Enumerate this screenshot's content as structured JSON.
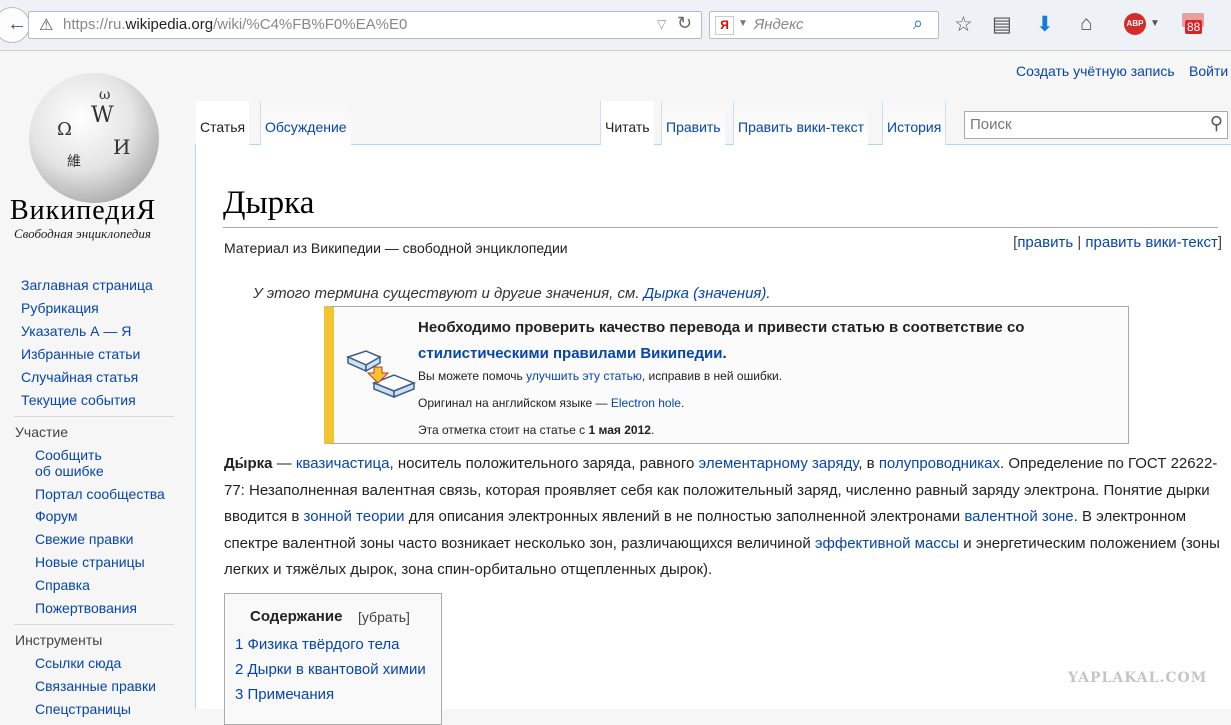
{
  "browser": {
    "back_glyph": "←",
    "warn_glyph": "⚠",
    "url_prefix": "https://ru.",
    "url_domain": "wikipedia.org",
    "url_path": "/wiki/%C4%FB%F0%EA%E0",
    "dropdown_glyph": "▽",
    "reload_glyph": "↻",
    "search_engine_logo": "Я",
    "search_placeholder": "Яндекс",
    "search_glyph": "⌕",
    "icons": [
      "star-icon",
      "reading-list-icon",
      "download-icon",
      "home-icon",
      "adblock-plus-icon",
      "mail-icon"
    ],
    "icon_glyphs": [
      "☆",
      "▤",
      "⬇",
      "⌂"
    ],
    "abp_label": "ABP",
    "mail_badge": "88"
  },
  "logo": {
    "globe_glyphs": [
      "Ω",
      "W",
      "И",
      "維",
      "ω"
    ],
    "wordmark": "ВикипедиЯ",
    "tagline": "Свободная энциклопедия"
  },
  "sidebar": {
    "main_links": [
      "Заглавная страница",
      "Рубрикация",
      "Указатель А — Я",
      "Избранные статьи",
      "Случайная статья",
      "Текущие события"
    ],
    "participation_heading": "Участие",
    "participation_links": [
      "Сообщить",
      "об ошибке",
      "Портал сообщества",
      "Форум",
      "Свежие правки",
      "Новые страницы",
      "Справка",
      "Пожертвования"
    ],
    "tools_heading": "Инструменты",
    "tools_links": [
      "Ссылки сюда",
      "Связанные правки",
      "Спецстраницы"
    ]
  },
  "personal": {
    "create_account": "Создать учётную запись",
    "login": "Войти"
  },
  "tabs": {
    "article": "Статья",
    "talk": "Обсуждение",
    "read": "Читать",
    "edit": "Править",
    "edit_source": "Править вики-текст",
    "history": "История"
  },
  "wiki_search": {
    "placeholder": "Поиск",
    "glyph": "⚲"
  },
  "article": {
    "title": "Дырка",
    "site_sub": "Материал из Википедии — свободной энциклопедии",
    "edit_open": "[",
    "edit": "править",
    "edit_sep": " | ",
    "edit_source": "править вики-текст",
    "edit_close": "]",
    "hatnote_text": "У этого термина существуют и другие значения, см. ",
    "hatnote_link": "Дырка (значения)",
    "hatnote_end": ".",
    "ambox": {
      "title_text": "Необходимо проверить качество перевода и привести статью в соответствие со ",
      "title_link": "стилистическими правилами Википедии",
      "title_end": ".",
      "help_text": "Вы можете помочь ",
      "help_link": "улучшить эту статью",
      "help_end": ", исправив в ней ошибки.",
      "orig_text": "Оригинал на английском языке — ",
      "orig_link": "Electron hole",
      "orig_end": ".",
      "date_text": "Эта отметка стоит на статье с ",
      "date_bold": "1 мая 2012",
      "date_end": "."
    },
    "paragraph": [
      {
        "t": "Ды́рка",
        "b": true
      },
      {
        "t": " — "
      },
      {
        "t": "квазичастица",
        "link": true
      },
      {
        "t": ", носитель положительного заряда, равного "
      },
      {
        "t": "элементарному заряду",
        "link": true
      },
      {
        "t": ", в "
      },
      {
        "t": "полупроводниках",
        "link": true
      },
      {
        "t": ". Определение по ГОСТ 22622-77: Незаполненная валентная связь, которая проявляет себя как положительный заряд, численно равный заряду электрона. Понятие дырки вводится в "
      },
      {
        "t": "зонной теории",
        "link": true
      },
      {
        "t": " для описания электронных явлений в не полностью заполненной электронами "
      },
      {
        "t": "валентной зоне",
        "link": true
      },
      {
        "t": ". В электронном спектре валентной зоны часто возникает несколько зон, различающихся величиной "
      },
      {
        "t": "эффективной массы",
        "link": true
      },
      {
        "t": " и энергетическим положением (зоны легких и тяжёлых дырок, зона спин-орбитально отщепленных дырок)."
      }
    ],
    "toc": {
      "title": "Содержание",
      "hide": "[убрать]",
      "items": [
        "1 Физика твёрдого тела",
        "2 Дырки в квантовой химии",
        "3 Примечания"
      ]
    }
  },
  "watermark": "YAPLAKAL.COM"
}
